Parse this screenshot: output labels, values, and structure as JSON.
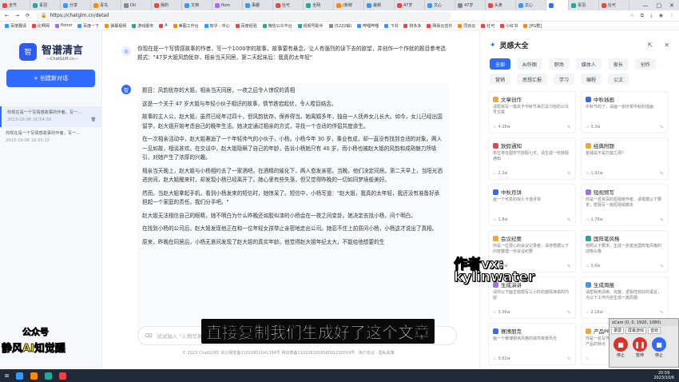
{
  "browser": {
    "tabs": [
      {
        "label": "全节",
        "color": "#e44"
      },
      {
        "label": "青羽",
        "color": "#2a9"
      },
      {
        "label": "分享",
        "color": "#39f"
      },
      {
        "label": "青鸟",
        "color": "#f80"
      },
      {
        "label": "DII",
        "color": "#888"
      },
      {
        "label": "我的",
        "color": "#e44"
      },
      {
        "label": "文档",
        "color": "#39f"
      },
      {
        "label": "flom",
        "color": "#a6f"
      },
      {
        "label": "事都",
        "color": "#39f"
      },
      {
        "label": "社可",
        "color": "#e44"
      },
      {
        "label": "全网",
        "color": "#2a9"
      },
      {
        "label": "(新鲜",
        "color": "#f80"
      },
      {
        "label": "最频",
        "color": "#39f"
      },
      {
        "label": "47岁",
        "color": "#e44"
      },
      {
        "label": "文心",
        "color": "#39f"
      },
      {
        "label": "47岁",
        "color": "#888"
      },
      {
        "label": "头条",
        "color": "#e44"
      },
      {
        "label": "文心",
        "color": "#39f"
      },
      {
        "label": "",
        "color": "#2f6bff"
      },
      {
        "label": "青羽",
        "color": "#2a9"
      },
      {
        "label": "社可",
        "color": "#e44"
      }
    ],
    "url": "https://chatglm.cn/detail",
    "bookmarks": [
      {
        "label": "百度翻译",
        "color": "#39f"
      },
      {
        "label": "比啊网",
        "color": "#e44"
      },
      {
        "label": "flomo",
        "color": "#a6f"
      },
      {
        "label": "百度一下",
        "color": "#39f"
      },
      {
        "label": "弹幕视频",
        "color": "#f80"
      },
      {
        "label": "游戏服务",
        "color": "#2a9"
      },
      {
        "label": "A",
        "color": "#e44"
      },
      {
        "label": "美图工作台",
        "color": "#f80"
      },
      {
        "label": "知乎 - 中心",
        "color": "#39f"
      },
      {
        "label": "百度经验",
        "color": "#e44"
      },
      {
        "label": "微信公众平台",
        "color": "#2a9"
      },
      {
        "label": "视频号助手",
        "color": "#2a9"
      },
      {
        "label": "(5222解)",
        "color": "#888"
      },
      {
        "label": "哔哩哔哩",
        "color": "#39f"
      },
      {
        "label": "飞书",
        "color": "#39f"
      },
      {
        "label": "拼多多",
        "color": "#e44"
      },
      {
        "label": "网易云音乐",
        "color": "#e44"
      },
      {
        "label": "同创云",
        "color": "#f80"
      },
      {
        "label": "社可",
        "color": "#e44"
      },
      {
        "label": "小红书",
        "color": "#e44"
      },
      {
        "label": "[PG群]",
        "color": "#f80"
      }
    ]
  },
  "sidebar": {
    "logo_mark": "智",
    "logo_title": "智谱清言",
    "logo_sub": "—ChatGLM.cn—",
    "new_chat": "+ 创建新对话",
    "history": [
      {
        "title": "你现在是一个写情感故事的作者。写一...",
        "date": "2023-10-06 20:54:39"
      },
      {
        "title": "你现在是一个写情感故事的作者，写一...",
        "date": "2023-10-06 16:25:15"
      }
    ]
  },
  "chat": {
    "user_question": "你现在是一个写情感故事的作者，写一个1000字的故事，故事要有悬念，让人有强烈的读下去的欲望，并创作一个作就的题目参考选题式：\"47岁大姐风韵犹存，相亲当天同居，第二天起床后：我真的太年轻\"",
    "answer_title": "题目：风韵犹存的大姐，相亲当天同居，一夜之后令人惊叹的真相",
    "paragraphs": [
      "这是一个关于 47 岁大姐与年轻小伙子相识的故事，情节跌宕起伏，令人瞠目结舌。",
      "故事的主人公，赵大姐，虽然已经年过四十，但风韵犹存，保养得当。她离婚多年，独自一人抚养女儿长大。如今，女儿已经出国留学，赵大姐开始考虑自己的晚年生活。她决定通过相亲的方式，寻找一个合适的伴侣共度余生。",
      "在一次相亲活动中，赵大姐邂逅了一个年轻帅气的小伙子，小杨。小杨今年 30 岁，事业有成，却一直没有找到合适的对象。两人一见如故，相谈甚欢。在交谈中，赵大姐隐瞒了自己的年龄，告诉小杨她只有 40 岁。而小杨也被赵大姐的风韵和成熟魅力所吸引，对她产生了浓厚的兴趣。",
      "相亲当天晚上，赵大姐与小杨相约去了一家酒吧。在酒精的催化下，两人愈发亲密。当晚，他们决定同居。第二天早上，当阳光洒进房间，赵大姐醒来时，却发现小杨已经离开了。她心里有些失落，但又觉得昨晚的一切如同梦境般美好。",
      "然而，当赵大姐拿起手机，看到小杨发来的短信时，她惊呆了。短信中，小杨写道：\"赵大姐，我真的太年轻，我还没有准备好承担起一个家庭的责任。我们分手吧。\"",
      "赵大姐无法相信自己的眼睛，她不明白为什么昨晚还如胶似漆的小杨会在一夜之间变卦。她决定去找小杨，问个明白。",
      "在找到小杨的公司后，赵大姐发现他正在和一位年轻女孩举止亲密地走出公司。她忍不住上前质问小杨，小杨这才说出了真相。",
      "原来，昨晚在同居后，小杨无意间发现了赵大姐的真实年龄。他觉得赵大姐年纪太大，不能给他想要的生"
    ],
    "input_placeholder": "试试输入 \"人物写真\"",
    "footer": "© 2023 ChatGLM2 京公网安备11010802041396号 网信算备110108105858001230019号 · 用户协议 · 隐私政策"
  },
  "panel": {
    "title": "灵感大全",
    "categories": [
      "全部",
      "AI作图",
      "职场",
      "媒体人",
      "家长",
      "创作",
      "营销",
      "思想汇报",
      "学习",
      "编程",
      "公文"
    ],
    "cards": [
      {
        "title": "文章创作",
        "desc": "请帮我写一篇关于中秋节来历及习俗的公众号文章",
        "count": "4.28w",
        "color": "#f5a623"
      },
      {
        "title": "中秋插画",
        "desc": "中秋节的了，请画一张庆祝中秋的插画",
        "count": "3.3w",
        "color": "#2f6bff"
      },
      {
        "title": "放假通知",
        "desc": "单位将在国庆节放假七天，请生成一份放假通知",
        "count": "2.2w",
        "color": "#e44"
      },
      {
        "title": "经典附题",
        "desc": "金钱是不是万能之源？",
        "count": "1.92w",
        "color": "#f5a623"
      },
      {
        "title": "中秋月饼",
        "desc": "画一个可爱的拟人卡通月饼",
        "count": "1.8w",
        "color": "#2f6bff"
      },
      {
        "title": "短视频写",
        "desc": "你是一名资深的短视频作者，请根据以下要求，帮我写一篇短视频脚本",
        "count": "1.78w",
        "color": "#a66bf0"
      },
      {
        "title": "会议纪要",
        "desc": "你是一位很心的会议记录者，请将根据以下内容整理一份会议纪要",
        "count": "4.2w",
        "color": "#f5a623"
      },
      {
        "title": "国阵笔风格",
        "desc": "按照以下要求，生成一张富含国阵笔风格的动物头像",
        "count": "3.6w",
        "color": "#2a9"
      },
      {
        "title": "生成演讲",
        "desc": "请你以下面主题帮写三小时的激情演讲的内容",
        "count": "3.36w",
        "color": "#a66bf0"
      },
      {
        "title": "生成周报",
        "desc": "请帮我用清晰、完整、逻辑性较好的语言，为以下工作内容生成一篇周报",
        "count": "2.18w",
        "color": "#39f"
      },
      {
        "title": "赛博朋克",
        "desc": "画一个赛博朋克风格的城市夜景风光",
        "count": "3.62w",
        "color": "#2f6bff"
      },
      {
        "title": "产品PR",
        "desc": "你是一名写作，编写生成一篇PR营文，描述产品的特点",
        "count": "",
        "color": "#f5a623"
      }
    ]
  },
  "overlay": {
    "author_line1": "作者vx:",
    "author_line2": "kylinwater",
    "caption": "直接复制我们生成好了这个文章",
    "gzh_line1": "公众号",
    "gzh_line2": "静风AI知觉醒"
  },
  "recorder": {
    "title": "oCam (0, 0, 1920, 1080)",
    "tabs": [
      "录屏",
      "屏幕游戏",
      "音效"
    ],
    "buttons": [
      "停止",
      "暂停",
      "停止"
    ]
  },
  "taskbar": {
    "time": "20:59",
    "date": "2023/10/6"
  }
}
